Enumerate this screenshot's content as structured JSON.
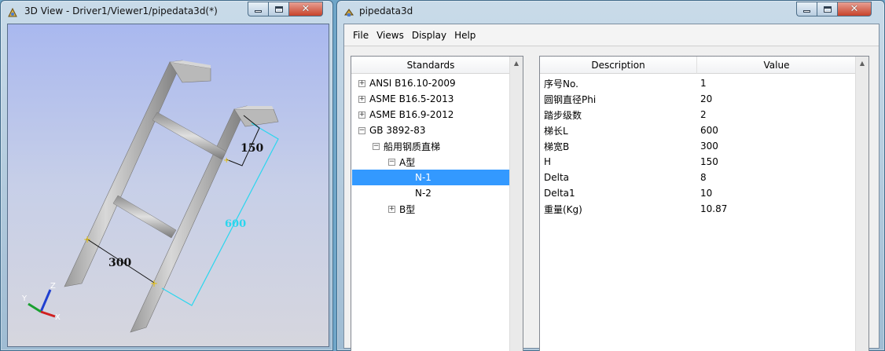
{
  "viewer": {
    "title": "3D View - Driver1/Viewer1/pipedata3d(*)",
    "dimensions": {
      "height": "150",
      "length": "600",
      "width": "300"
    },
    "axes": {
      "x": "X",
      "y": "Y",
      "z": "Z"
    }
  },
  "app": {
    "title": "pipedata3d",
    "menu": [
      "File",
      "Views",
      "Display",
      "Help"
    ],
    "standards_header": "Standards",
    "tree": [
      {
        "label": "ANSI B16.10-2009",
        "expander": "+"
      },
      {
        "label": "ASME B16.5-2013",
        "expander": "+"
      },
      {
        "label": "ASME B16.9-2012",
        "expander": "+"
      },
      {
        "label": "GB 3892-83",
        "expander": "−"
      },
      {
        "label": "船用钢质直梯",
        "expander": "−"
      },
      {
        "label": "A型",
        "expander": "−"
      },
      {
        "label": "N-1",
        "expander": "",
        "selected": true
      },
      {
        "label": "N-2",
        "expander": ""
      },
      {
        "label": "B型",
        "expander": "+"
      }
    ],
    "table": {
      "headers": {
        "description": "Description",
        "value": "Value"
      },
      "rows": [
        {
          "description": "序号No.",
          "value": "1"
        },
        {
          "description": "圆钢直径Phi",
          "value": "20"
        },
        {
          "description": "踏步级数",
          "value": "2"
        },
        {
          "description": "梯长L",
          "value": "600"
        },
        {
          "description": "梯宽B",
          "value": "300"
        },
        {
          "description": "H",
          "value": "150"
        },
        {
          "description": "Delta",
          "value": "8"
        },
        {
          "description": "Delta1",
          "value": "10"
        },
        {
          "description": "重量(Kg)",
          "value": "10.87"
        }
      ]
    }
  },
  "colors": {
    "selection": "#3399ff",
    "dimension_cyan": "#2ad6ee",
    "window_frame": "#9fbcd3"
  }
}
